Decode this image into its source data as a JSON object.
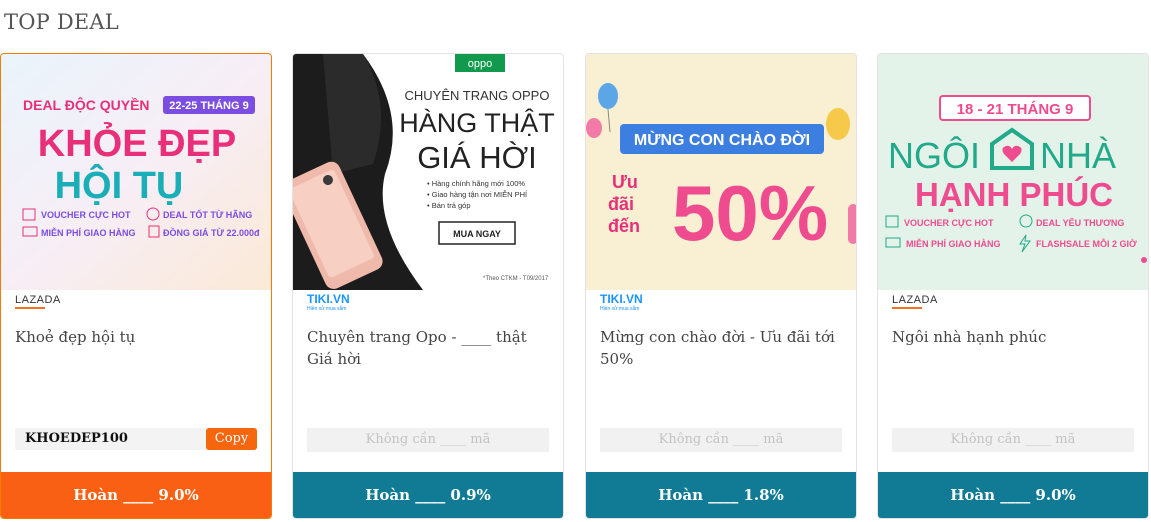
{
  "section": {
    "title": "TOP DEAL"
  },
  "colors": {
    "accent_orange": "#fa6013",
    "accent_teal": "#117b96",
    "copy_button": "#f5660f"
  },
  "cards": [
    {
      "store": "LAZADA",
      "title": "Khoẻ đẹp hội tụ",
      "code": "KHOEDEP100",
      "copy_label": "Copy",
      "cashback": "Hoàn ____ 9.0%",
      "banner": {
        "line1": "DEAL ĐỘC QUYỀN",
        "date": "22-25 THÁNG 9",
        "headline1": "KHỎE ĐẸP",
        "headline2": "HỘI TỤ",
        "perks": [
          "VOUCHER CỰC HOT",
          "DEAL TỐT TỪ HÃNG",
          "MIỄN PHÍ GIAO HÀNG",
          "ĐỒNG GIÁ TỪ 22.000đ"
        ]
      }
    },
    {
      "store": "TIKI.VN",
      "store_tagline": "Hiền xử mua sắm",
      "title": "Chuyên trang Opo - ____ thật Giá hời",
      "no_code_label": "Không cần ____ mã",
      "cashback": "Hoàn ____ 0.9%",
      "banner": {
        "brand": "oppo",
        "line1": "CHUYÊN TRANG OPPO",
        "headline1": "HÀNG THẬT",
        "headline2": "GIÁ HỜI",
        "bullets": [
          "Hàng chính hãng mới 100%",
          "Giao hàng tận nơi MIỄN PHÍ",
          "Bán trả góp"
        ],
        "cta": "MUA NGAY",
        "note": "*Theo CTKM - T09/2017"
      }
    },
    {
      "store": "TIKI.VN",
      "store_tagline": "Hiền xử mua sắm",
      "title": "Mừng con chào đời - Ưu đãi tới 50%",
      "no_code_label": "Không cần ____ mã",
      "cashback": "Hoàn ____ 1.8%",
      "banner": {
        "headline": "MỪNG CON CHÀO ĐỜI",
        "prefix1": "Ưu",
        "prefix2": "đãi",
        "prefix3": "đến",
        "percent": "50%"
      }
    },
    {
      "store": "LAZADA",
      "title": "Ngôi nhà hạnh phúc",
      "no_code_label": "Không cần ____ mã",
      "cashback": "Hoàn ____ 9.0%",
      "banner": {
        "date": "18 - 21 THÁNG 9",
        "headline1a": "NGÔI",
        "headline1b": "NHÀ",
        "headline2": "HẠNH PHÚC",
        "perks": [
          "VOUCHER CỰC HOT",
          "DEAL YÊU THƯƠNG",
          "MIỄN PHÍ GIAO HÀNG",
          "FLASHSALE MỖI 2 GIỜ"
        ]
      }
    }
  ]
}
